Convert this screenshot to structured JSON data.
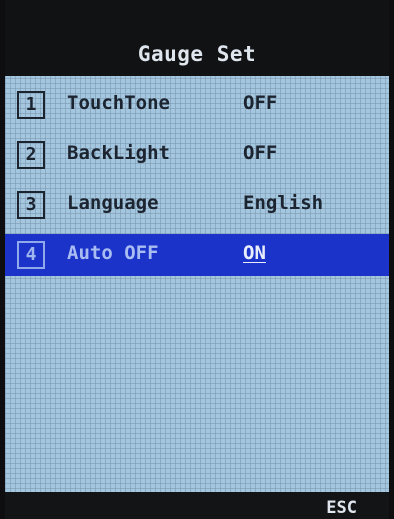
{
  "header": {
    "title": "Gauge Set"
  },
  "menu": {
    "items": [
      {
        "number": "1",
        "label": "TouchTone",
        "value": "OFF"
      },
      {
        "number": "2",
        "label": "BackLight",
        "value": "OFF"
      },
      {
        "number": "3",
        "label": "Language",
        "value": "English"
      },
      {
        "number": "4",
        "label": "Auto OFF",
        "value": "ON",
        "selected": true
      }
    ]
  },
  "footer": {
    "esc_label": "ESC"
  },
  "colors": {
    "screen_bg": "#a4c6df",
    "selection": "#1b33c9",
    "bar_bg": "#111214"
  }
}
